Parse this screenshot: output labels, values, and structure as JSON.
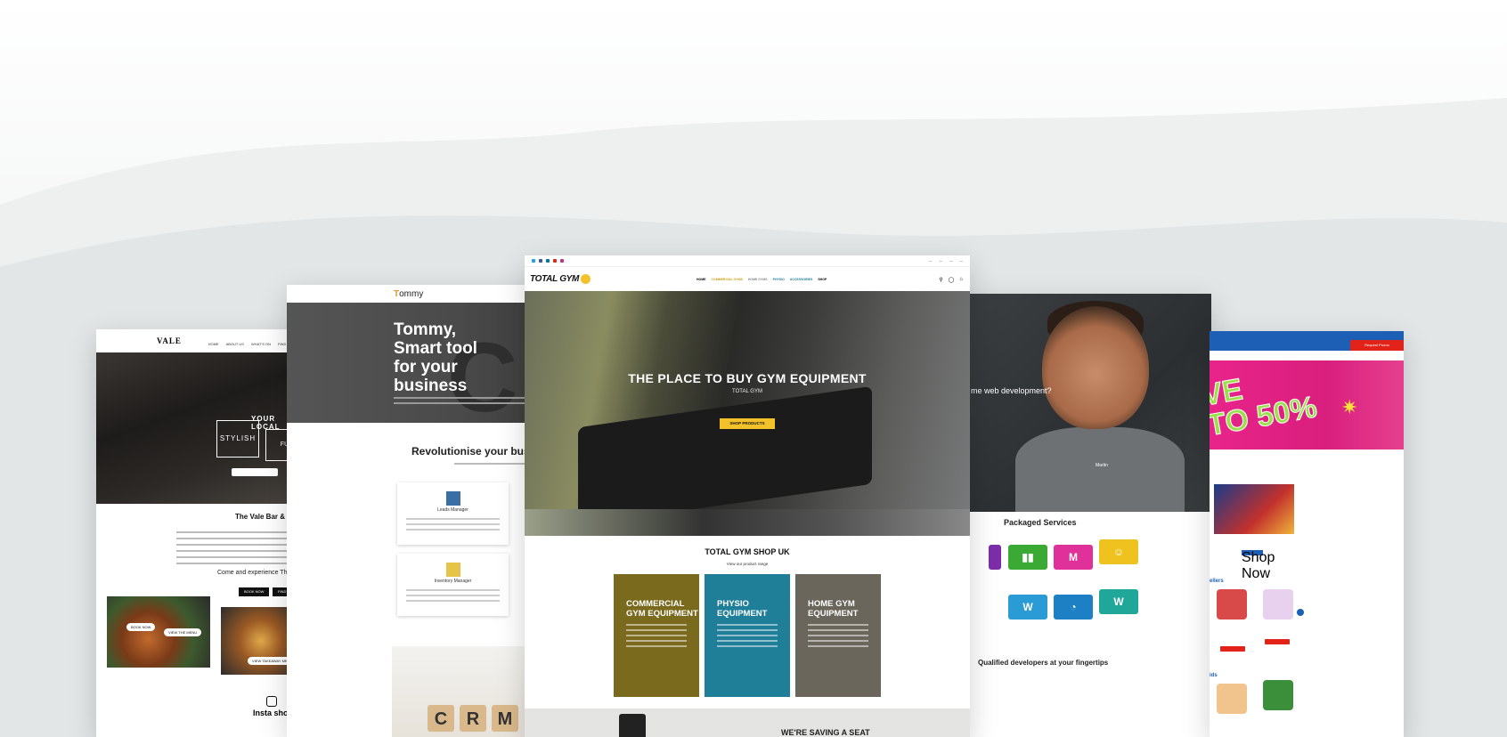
{
  "vale": {
    "logo": "VALE",
    "nav": [
      "HOME",
      "ABOUT US",
      "WHAT'S ON",
      "FIND US"
    ],
    "hero_left": "STYLISH",
    "hero_tag": "YOUR LOCAL",
    "hero_right": "FUN",
    "title": "The Vale Bar & Br",
    "come": "Come and experience The",
    "book_now": "BOOK NOW",
    "find_out": "FIND OU",
    "view_menu": "VIEW THE MENU",
    "book_now_2": "BOOK NOW",
    "view_takeaway": "VIEW TAKEAWAY MEN",
    "insta": "Insta sho"
  },
  "tommy": {
    "logo_t": "T",
    "logo_rest": "ommy",
    "hero_title": "Tommy, Smart tool for your business",
    "revolutionise": "Revolutionise your business",
    "box1": "Leads Manager",
    "box2": "Inventory Manager",
    "cube_letters": [
      "C",
      "R",
      "M"
    ]
  },
  "gym": {
    "logo": "TOTAL GYM",
    "menu": [
      "HOME",
      "COMMERCIAL GYMS",
      "HOME GYMS",
      "PHYSIO",
      "ACCESSORIES",
      "SHOP"
    ],
    "hero_title": "THE PLACE TO BUY GYM EQUIPMENT",
    "hero_sub": "TOTAL GYM",
    "cta": "SHOP PRODUCTS",
    "shop_title": "TOTAL GYM SHOP UK",
    "range": "View our product range",
    "tiles": [
      {
        "title": "COMMERCIAL\nGYM EQUIPMENT",
        "color": "#7a6a1e"
      },
      {
        "title": "PHYSIO\nEQUIPMENT",
        "color": "#1f7f98"
      },
      {
        "title": "HOME GYM\nEQUIPMENT",
        "color": "#6b665c"
      }
    ],
    "seat": "WE'RE SAVING A SEAT"
  },
  "dev": {
    "question": "me web development?",
    "name": "Martin",
    "packaged": "Packaged Services",
    "qualified": "Qualified developers at your fingertips",
    "icon_colors": [
      "#7b2ea8",
      "#3aaa35",
      "#e0309a",
      "#f0c21f",
      "#2b9bd6",
      "#1d7fc4",
      "#1a8fd0",
      "#1fa79a"
    ]
  },
  "toy": {
    "sale": "VE\nTO 50%",
    "request": "Request Promo",
    "shop_now": "Shop Now",
    "sellers": "ellers",
    "kids": "ids",
    "add_btn": "Add to Basket"
  }
}
